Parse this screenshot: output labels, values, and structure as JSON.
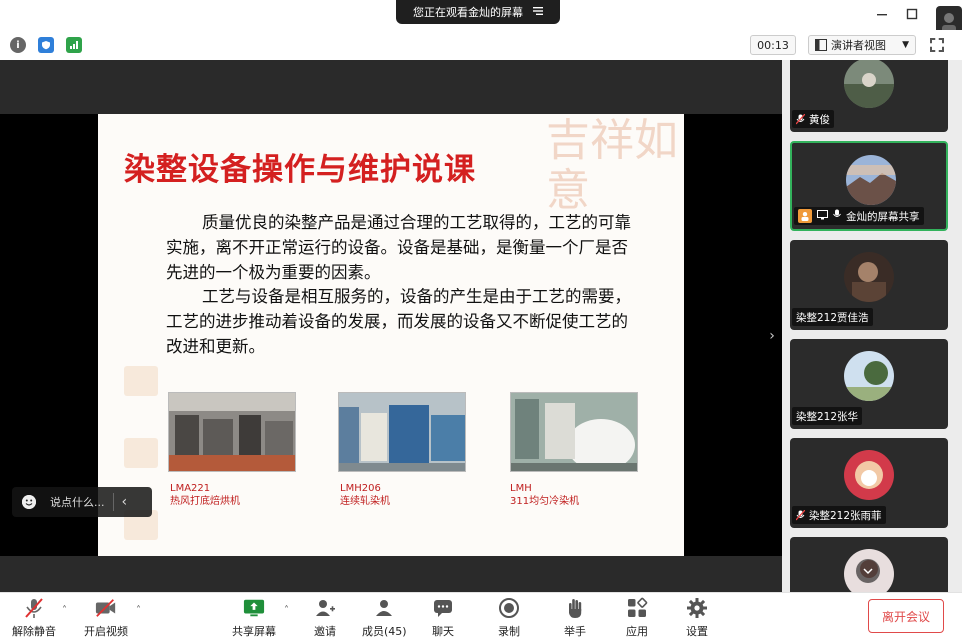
{
  "banner": {
    "text": "您正在观看金灿的屏幕",
    "menu_icon": "menu-icon"
  },
  "titlebar": {
    "minimize_icon": "minimize-icon",
    "maximize_icon": "maximize-icon"
  },
  "toolbar": {
    "timer": "00:13",
    "view_label": "演讲者视图",
    "icons": [
      "info-icon",
      "shield-icon",
      "signal-icon",
      "fullscreen-icon"
    ]
  },
  "slide": {
    "title": "染整设备操作与维护说课",
    "deco_text": "吉祥如意",
    "paragraph1": "质量优良的染整产品是通过合理的工艺取得的，工艺的可靠实施，离不开正常运行的设备。设备是基础，是衡量一个厂是否先进的一个极为重要的因素。",
    "paragraph2": "工艺与设备是相互服务的，设备的产生是由于工艺的需要，工艺的进步推动着设备的发展，而发展的设备又不断促使工艺的改进和更新。",
    "machines": [
      {
        "code": "LMA221",
        "name": "热风打底焙烘机"
      },
      {
        "code": "LMH206",
        "name": "连续轧染机"
      },
      {
        "code": "LMH",
        "name": "311均匀冷染机"
      }
    ]
  },
  "chat": {
    "placeholder": "说点什么...",
    "emoji_icon": "emoji-icon",
    "collapse_icon": "chevron-left-icon"
  },
  "participants": [
    {
      "name": "黄俊",
      "muted": true
    },
    {
      "name": "金灿的屏幕共享",
      "muted": false,
      "sharing": true
    },
    {
      "name": "染整212贾佳浩",
      "muted": false
    },
    {
      "name": "染整212张华",
      "muted": false
    },
    {
      "name": "染整212张雨菲",
      "muted": true
    },
    {
      "name": "",
      "muted": false
    }
  ],
  "bottombar": {
    "unmute": "解除静音",
    "start_video": "开启视频",
    "share_screen": "共享屏幕",
    "invite": "邀请",
    "members": "成员(45)",
    "chat": "聊天",
    "record": "录制",
    "raise_hand": "举手",
    "apps": "应用",
    "settings": "设置",
    "leave": "离开会议"
  },
  "colors": {
    "slide_title": "#d42020",
    "active_border": "#33b25c",
    "leave": "#e04a4a",
    "share_green": "#1f8f3a"
  }
}
